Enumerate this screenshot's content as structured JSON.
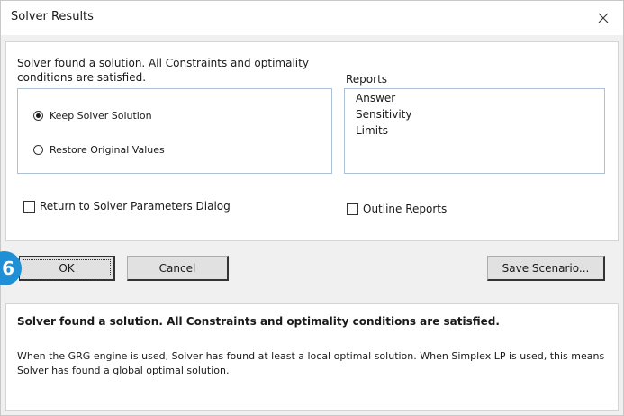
{
  "dialog": {
    "title": "Solver Results",
    "close_icon": "close-icon"
  },
  "top_message": "Solver found a solution.  All Constraints and optimality conditions are satisfied.",
  "options": {
    "keep": {
      "label": "Keep Solver Solution",
      "selected": true
    },
    "restore": {
      "label": "Restore Original Values",
      "selected": false
    }
  },
  "reports": {
    "label": "Reports",
    "items": [
      "Answer",
      "Sensitivity",
      "Limits"
    ]
  },
  "checkboxes": {
    "return_to_params": {
      "label": "Return to Solver Parameters Dialog",
      "checked": false
    },
    "outline_reports": {
      "label": "Outline Reports",
      "checked": false
    }
  },
  "buttons": {
    "ok": "OK",
    "cancel": "Cancel",
    "save_scenario": "Save Scenario..."
  },
  "step_badge": "6",
  "info": {
    "title": "Solver found a solution.  All Constraints and optimality conditions are satisfied.",
    "body": "When the GRG engine is used, Solver has found at least a local optimal solution. When Simplex LP is used, this means Solver has found a global optimal solution."
  },
  "colors": {
    "badge": "#1f8fd6",
    "box_border": "#adc0d6"
  }
}
